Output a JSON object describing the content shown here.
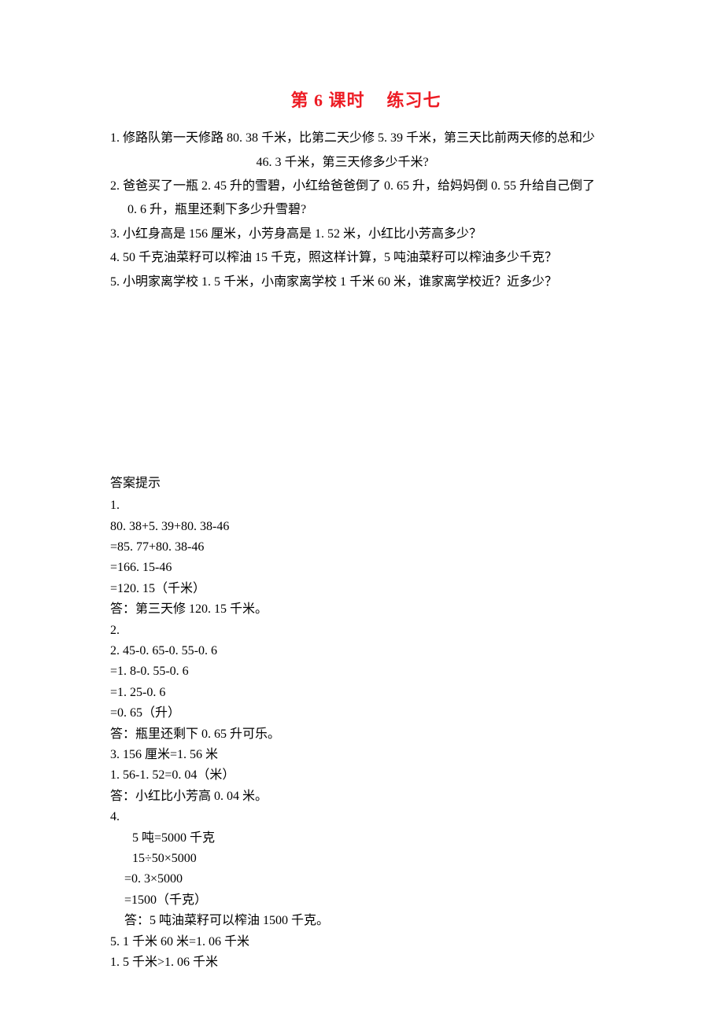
{
  "title_part1": "第 6 课时",
  "title_part2": "练习七",
  "questions": {
    "q1_line1": "1. 修路队第一天修路 80. 38 千米，比第二天少修 5. 39 千米，第三天比前两天修的总和少",
    "q1_line2": "46. 3 千米，第三天修多少千米?",
    "q2_line1": "2. 爸爸买了一瓶 2. 45 升的雪碧，小红给爸爸倒了 0. 65 升，给妈妈倒 0. 55 升给自己倒了",
    "q2_line2": "0. 6 升，瓶里还剩下多少升雪碧?",
    "q3": "3.  小红身高是 156 厘米，小芳身高是 1. 52 米，小红比小芳高多少？",
    "q4": "4.  50 千克油菜籽可以榨油 15 千克，照这样计算，5 吨油菜籽可以榨油多少千克？",
    "q5": "5.  小明家离学校 1. 5 千米，小南家离学校 1 千米 60 米，谁家离学校近？近多少？"
  },
  "answers": {
    "heading": "答案提示",
    "a1": {
      "num": "1.",
      "l1": " 80. 38+5. 39+80. 38-46",
      "l2": "=85. 77+80. 38-46",
      "l3": "=166. 15-46",
      "l4": "=120. 15（千米）",
      "l5": "答：第三天修 120. 15 千米。"
    },
    "a2": {
      "num": " 2.",
      "l1": " 2. 45-0. 65-0. 55-0. 6",
      "l2": "=1. 8-0. 55-0. 6",
      "l3": "=1. 25-0. 6",
      "l4": "=0. 65（升）",
      "l5": "答：瓶里还剩下 0. 65 升可乐。"
    },
    "a3": {
      "l1": "3.  156 厘米=1. 56 米",
      "l2": "1. 56-1. 52=0. 04（米）",
      "l3": "答：小红比小芳高 0. 04 米。"
    },
    "a4": {
      "num": "4.",
      "l1": "5 吨=5000 千克",
      "l2": "15÷50×5000",
      "l3": "=0. 3×5000",
      "l4": "=1500（千克）",
      "l5": "答：5 吨油菜籽可以榨油 1500 千克。"
    },
    "a5": {
      "l1": "5.  1 千米 60 米=1. 06 千米",
      "l2": "1. 5 千米>1. 06 千米"
    }
  }
}
